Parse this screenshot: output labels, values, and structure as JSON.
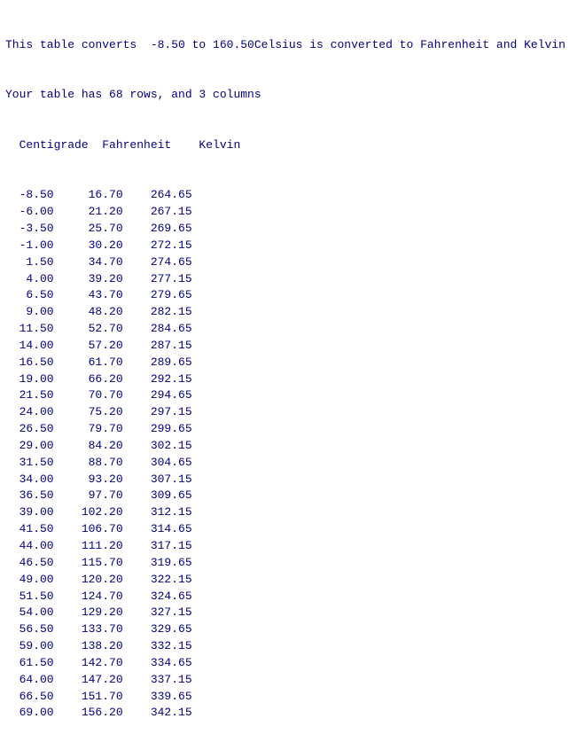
{
  "header": {
    "line1": "This table converts  -8.50 to 160.50Celsius is converted to Fahrenheit and Kelvin",
    "line2": "Your table has 68 rows, and 3 columns",
    "col1": "Centigrade",
    "col2": "Fahrenheit",
    "col3": "Kelvin"
  },
  "rows": [
    [
      "-8.50",
      "16.70",
      "264.65"
    ],
    [
      "-6.00",
      "21.20",
      "267.15"
    ],
    [
      "-3.50",
      "25.70",
      "269.65"
    ],
    [
      "-1.00",
      "30.20",
      "272.15"
    ],
    [
      "1.50",
      "34.70",
      "274.65"
    ],
    [
      "4.00",
      "39.20",
      "277.15"
    ],
    [
      "6.50",
      "43.70",
      "279.65"
    ],
    [
      "9.00",
      "48.20",
      "282.15"
    ],
    [
      "11.50",
      "52.70",
      "284.65"
    ],
    [
      "14.00",
      "57.20",
      "287.15"
    ],
    [
      "16.50",
      "61.70",
      "289.65"
    ],
    [
      "19.00",
      "66.20",
      "292.15"
    ],
    [
      "21.50",
      "70.70",
      "294.65"
    ],
    [
      "24.00",
      "75.20",
      "297.15"
    ],
    [
      "26.50",
      "79.70",
      "299.65"
    ],
    [
      "29.00",
      "84.20",
      "302.15"
    ],
    [
      "31.50",
      "88.70",
      "304.65"
    ],
    [
      "34.00",
      "93.20",
      "307.15"
    ],
    [
      "36.50",
      "97.70",
      "309.65"
    ],
    [
      "39.00",
      "102.20",
      "312.15"
    ],
    [
      "41.50",
      "106.70",
      "314.65"
    ],
    [
      "44.00",
      "111.20",
      "317.15"
    ],
    [
      "46.50",
      "115.70",
      "319.65"
    ],
    [
      "49.00",
      "120.20",
      "322.15"
    ],
    [
      "51.50",
      "124.70",
      "324.65"
    ],
    [
      "54.00",
      "129.20",
      "327.15"
    ],
    [
      "56.50",
      "133.70",
      "329.65"
    ],
    [
      "59.00",
      "138.20",
      "332.15"
    ],
    [
      "61.50",
      "142.70",
      "334.65"
    ],
    [
      "64.00",
      "147.20",
      "337.15"
    ],
    [
      "66.50",
      "151.70",
      "339.65"
    ],
    [
      "69.00",
      "156.20",
      "342.15"
    ]
  ]
}
